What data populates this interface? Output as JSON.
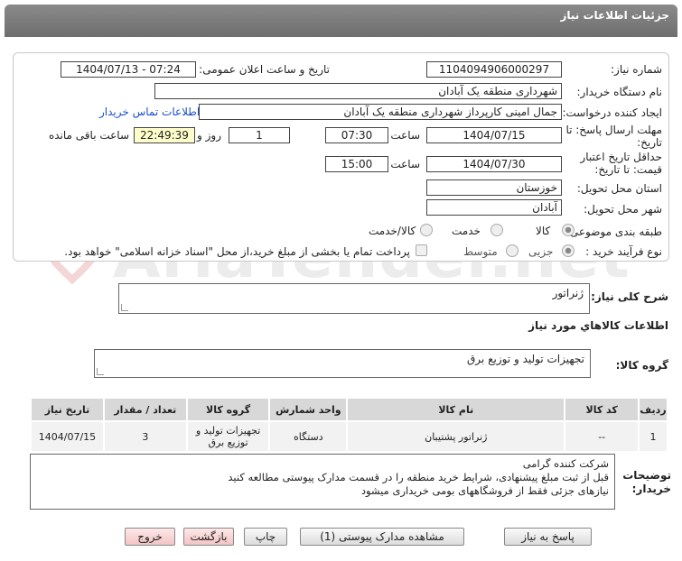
{
  "header": {
    "title": "جزئیات اطلاعات نیاز"
  },
  "form": {
    "need_number_label": "شماره نیاز:",
    "need_number": "1104094906000297",
    "announce_label": "تاریخ و ساعت اعلان عمومی:",
    "announce_value": "1404/07/13 - 07:24",
    "buyer_org_label": "نام دستگاه خریدار:",
    "buyer_org": "شهرداری منطقه یک آبادان",
    "creator_label": "ایجاد کننده درخواست:",
    "creator": "جمال امینی کارپرداز شهرداری منطقه یک آبادان",
    "contact_link": "اطلاعات تماس خریدار",
    "deadline_label": "مهلت ارسال پاسخ: تا تاریخ:",
    "deadline_date": "1404/07/15",
    "time_label": "ساعت",
    "deadline_time": "07:30",
    "days_value": "1",
    "days_label": "روز و",
    "remaining_time": "22:49:39",
    "remaining_label": "ساعت باقی مانده",
    "price_validity_label": "حداقل تاریخ اعتبار قیمت: تا تاریخ:",
    "price_validity_date": "1404/07/30",
    "price_validity_time": "15:00",
    "province_label": "استان محل تحویل:",
    "province": "خوزستان",
    "city_label": "شهر محل تحویل:",
    "city": "آبادان",
    "category_label": "طبقه بندی موضوعی:",
    "category_options": [
      "کالا",
      "خدمت",
      "کالا/خدمت"
    ],
    "category_selected": "کالا",
    "process_label": "نوع فرآیند خرید :",
    "process_options": [
      "جزیی",
      "متوسط"
    ],
    "process_selected": "جزیی",
    "payment_note": "پرداخت تمام یا بخشی از مبلغ خرید،از محل \"اسناد خزانه اسلامی\" خواهد بود."
  },
  "summary": {
    "label": "شرح کلی نیاز:",
    "value": "ژنراتور"
  },
  "goods_info": {
    "title": "اطلاعات کالاهاي مورد نياز",
    "group_label": "گروه کالا:",
    "group_value": "تجهیزات تولید و توزیع برق"
  },
  "table": {
    "headers": [
      "ردیف",
      "کد کالا",
      "نام کالا",
      "واحد شمارش",
      "گروه کالا",
      "تعداد / مقدار",
      "تاریخ نیاز"
    ],
    "rows": [
      [
        "1",
        "--",
        "ژنراتور پشتیبان",
        "دستگاه",
        "تجهیزات تولید و توزیع برق",
        "3",
        "1404/07/15"
      ]
    ]
  },
  "buyer_notes": {
    "label": "توضیحات خریدار:",
    "lines": [
      "شرکت کننده گرامی",
      "قبل از ثبت مبلغ پیشنهادی، شرایط خرید منطقه را در قسمت مدارک پیوستی مطالعه کنید",
      "نیازهای جزئی فقط از فروشگاههای بومی خریداری میشود"
    ]
  },
  "buttons": {
    "reply": "پاسخ به نیاز",
    "attachments": "مشاهده مدارک پیوستی (1)",
    "print": "چاپ",
    "back": "بازگشت",
    "exit": "خروج"
  },
  "watermark": {
    "text": "AriaTender.net"
  },
  "colors": {
    "header_bg": "#7a7a7a",
    "link": "#1a4fc8",
    "highlight": "#ffffcc",
    "button_red": "#f4c4c4"
  }
}
